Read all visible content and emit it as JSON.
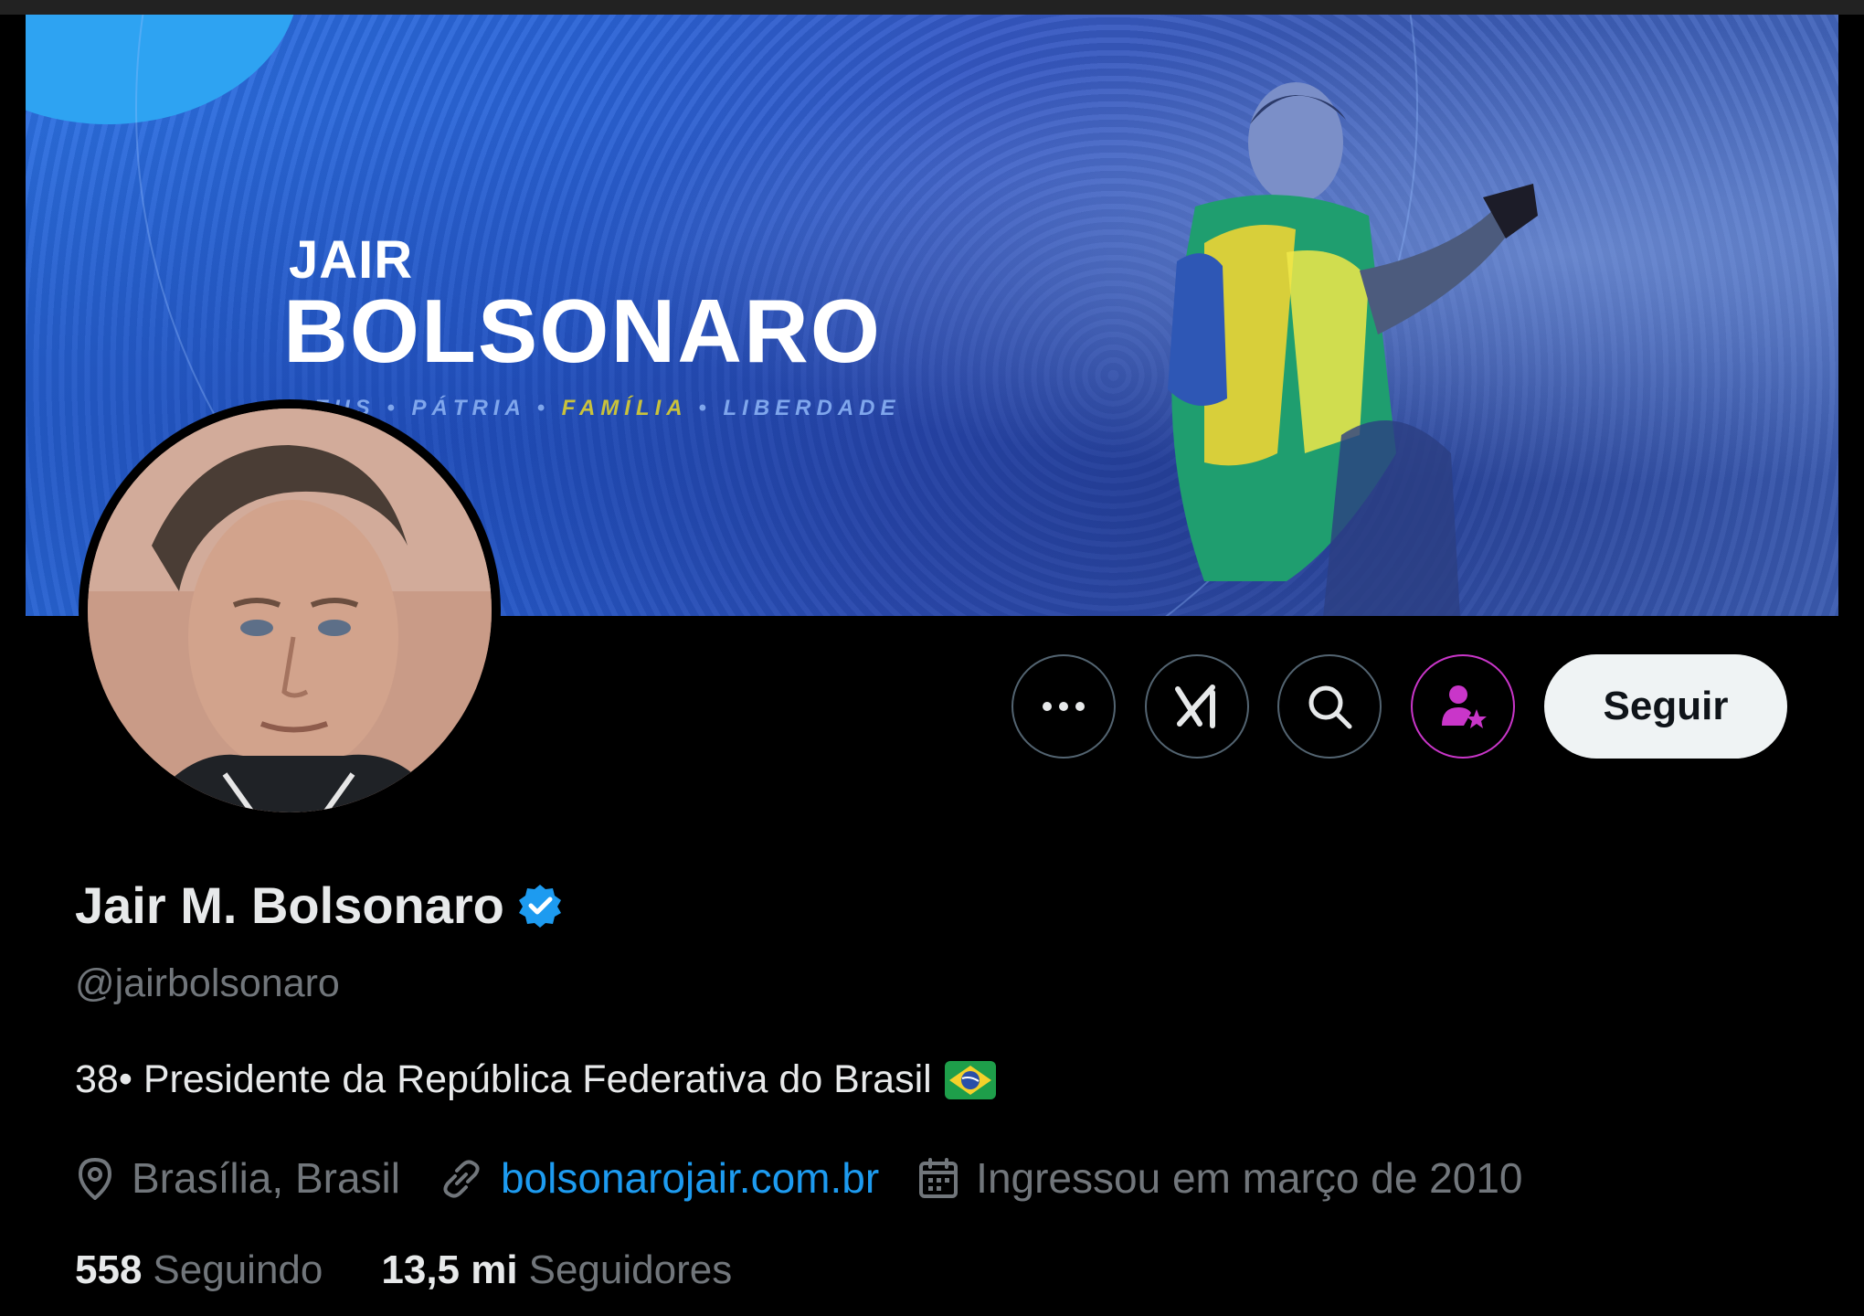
{
  "banner": {
    "title_small": "JAIR",
    "title_big": "BOLSONARO",
    "slogan": [
      "DEUS",
      "PÁTRIA",
      "FAMÍLIA",
      "LIBERDADE"
    ],
    "slogan_separator": "•"
  },
  "actions": {
    "more_icon": "more-icon",
    "grok_icon": "grok-icon",
    "search_icon": "search-icon",
    "subscribe_icon": "subscribe-icon",
    "follow_label": "Seguir"
  },
  "profile": {
    "name": "Jair M. Bolsonaro",
    "verified_icon": "verified-badge-icon",
    "handle": "@jairbolsonaro",
    "bio": "38• Presidente da República Federativa do Brasil",
    "bio_flag_icon": "brazil-flag-icon",
    "location": "Brasília, Brasil",
    "website": "bolsonarojair.com.br",
    "joined": "Ingressou em março de 2010",
    "following_count": "558",
    "following_label": "Seguindo",
    "followers_count": "13,5 mi",
    "followers_label": "Seguidores"
  },
  "colors": {
    "accent_link": "#1d9bf0",
    "verified": "#1d9bf0",
    "subscribe_ring": "#c936c9",
    "muted_text": "#71767b"
  }
}
